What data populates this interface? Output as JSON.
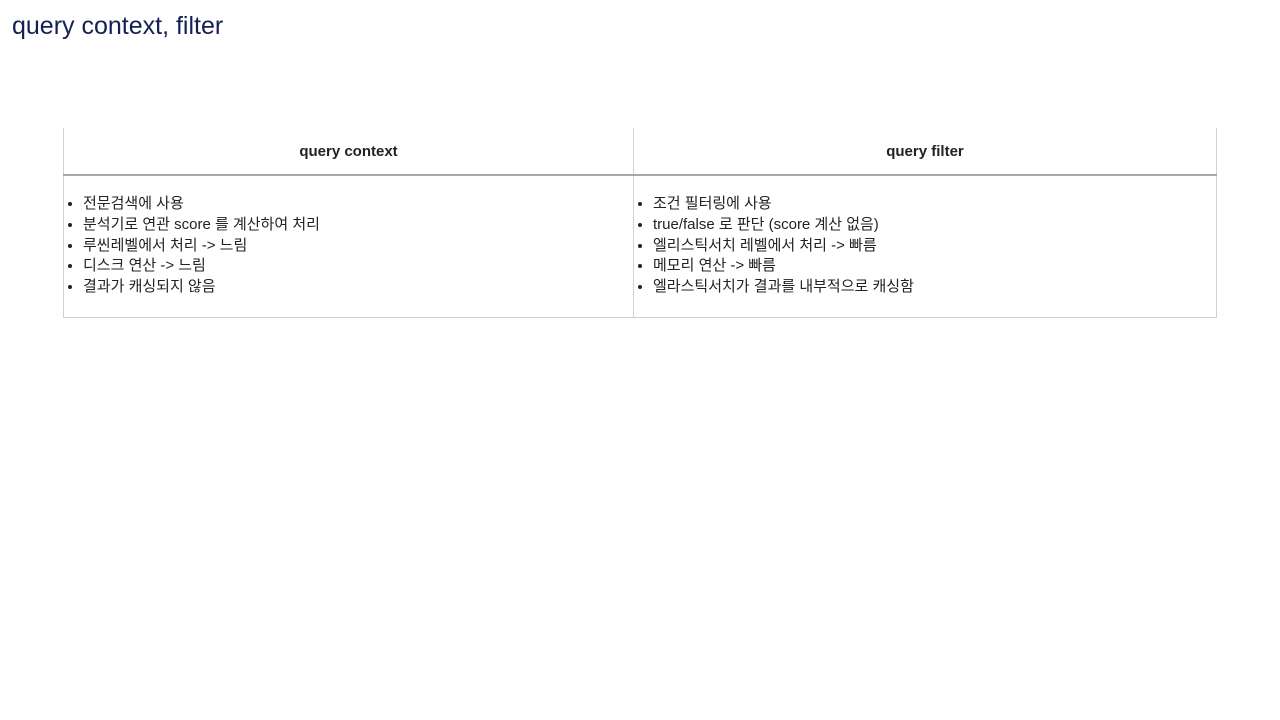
{
  "page": {
    "title": "query context, filter"
  },
  "table": {
    "columns": [
      {
        "header": "query context",
        "items": [
          "전문검색에 사용",
          "분석기로 연관 score 를 계산하여 처리",
          "루씬레벨에서 처리 -> 느림",
          "디스크 연산 -> 느림",
          "결과가 캐싱되지 않음"
        ]
      },
      {
        "header": "query filter",
        "items": [
          "조건 필터링에 사용",
          "true/false 로 판단 (score 계산 없음)",
          "엘리스틱서치 레벨에서 처리 -> 빠름",
          "메모리 연산 -> 빠름",
          "엘라스틱서치가 결과를 내부적으로 캐싱함"
        ]
      }
    ]
  }
}
